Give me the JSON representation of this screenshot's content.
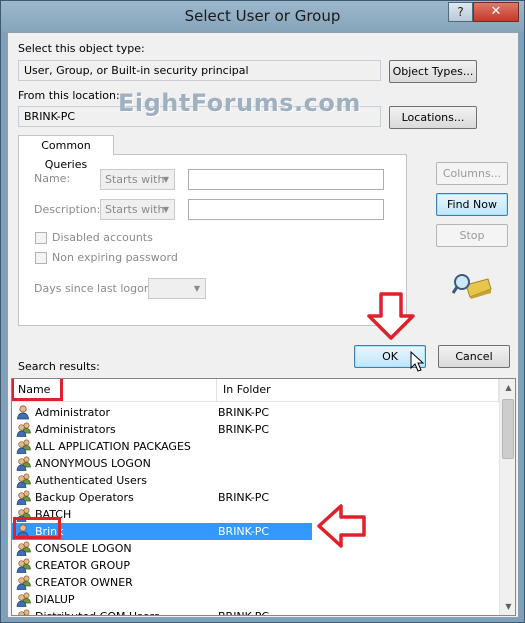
{
  "window": {
    "title": "Select User or Group",
    "help_label": "?",
    "close_label": "✕"
  },
  "object_type": {
    "label": "Select this object type:",
    "value": "User, Group, or Built-in security principal",
    "button": "Object Types..."
  },
  "location": {
    "label": "From this location:",
    "value": "BRINK-PC",
    "button": "Locations..."
  },
  "watermark": "EightForums.com",
  "queries": {
    "tab_label": "Common Queries",
    "name_label": "Name:",
    "name_combo": "Starts with",
    "description_label": "Description:",
    "description_combo": "Starts with",
    "disabled_accounts": "Disabled accounts",
    "non_expiring_password": "Non expiring password",
    "days_since_logon": "Days since last logon:"
  },
  "side_buttons": {
    "columns": "Columns...",
    "find_now": "Find Now",
    "stop": "Stop"
  },
  "actions": {
    "ok": "OK",
    "cancel": "Cancel"
  },
  "results": {
    "label": "Search results:",
    "columns": [
      "Name",
      "In Folder"
    ],
    "rows": [
      {
        "name": "Administrator",
        "folder": "BRINK-PC",
        "icon": "user-icon"
      },
      {
        "name": "Administrators",
        "folder": "BRINK-PC",
        "icon": "group-icon"
      },
      {
        "name": "ALL APPLICATION PACKAGES",
        "folder": "",
        "icon": "group-icon"
      },
      {
        "name": "ANONYMOUS LOGON",
        "folder": "",
        "icon": "group-icon"
      },
      {
        "name": "Authenticated Users",
        "folder": "",
        "icon": "group-icon"
      },
      {
        "name": "Backup Operators",
        "folder": "BRINK-PC",
        "icon": "group-icon"
      },
      {
        "name": "BATCH",
        "folder": "",
        "icon": "group-icon"
      },
      {
        "name": "Brink",
        "folder": "BRINK-PC",
        "icon": "user-icon",
        "selected": true
      },
      {
        "name": "CONSOLE LOGON",
        "folder": "",
        "icon": "group-icon"
      },
      {
        "name": "CREATOR GROUP",
        "folder": "",
        "icon": "group-icon"
      },
      {
        "name": "CREATOR OWNER",
        "folder": "",
        "icon": "group-icon"
      },
      {
        "name": "DIALUP",
        "folder": "",
        "icon": "group-icon"
      },
      {
        "name": "Distributed COM Users",
        "folder": "BRINK-PC",
        "icon": "group-icon"
      }
    ]
  },
  "colors": {
    "selection": "#3399ff",
    "annotation_red": "#e0202a"
  }
}
